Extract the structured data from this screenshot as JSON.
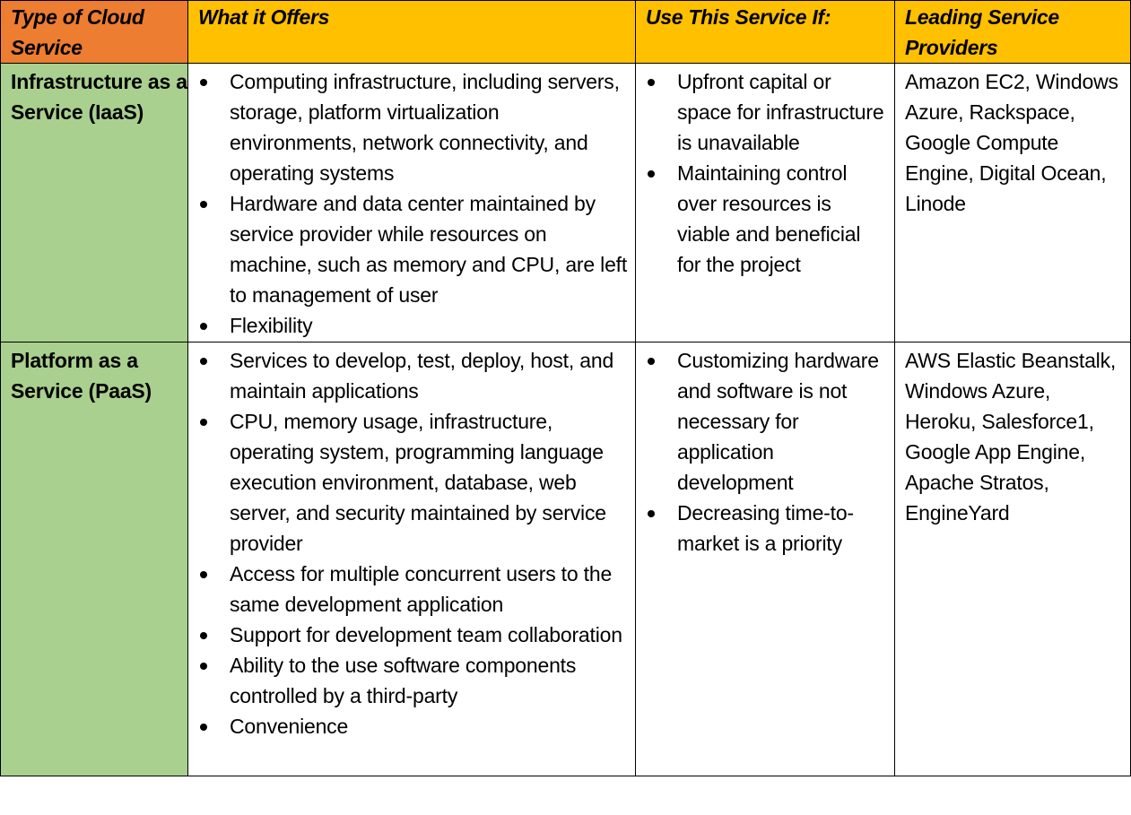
{
  "colors": {
    "header_first": "#ED7D31",
    "header_rest": "#FFC000",
    "type_column": "#A9D08E",
    "body": "#FFFFFF",
    "border": "#000000"
  },
  "table": {
    "headers": [
      "Type of Cloud Service",
      "What it Offers",
      "Use This Service If:",
      "Leading Service Providers"
    ],
    "rows": [
      {
        "type": "Infrastructure as a Service (IaaS)",
        "offers": [
          "Computing infrastructure, including servers, storage, platform virtualization environments, network connectivity, and operating systems",
          "Hardware and data center maintained by service provider while resources on machine, such as memory and CPU, are left to management of user",
          "Flexibility"
        ],
        "use_if": [
          "Upfront capital or space for infrastructure is unavailable",
          "Maintaining control over resources is viable and beneficial for the project"
        ],
        "providers": "Amazon EC2, Windows Azure, Rackspace, Google Compute Engine, Digital Ocean, Linode"
      },
      {
        "type": "Platform as a Service (PaaS)",
        "offers": [
          "Services to develop, test, deploy, host, and maintain applications",
          "CPU, memory usage, infrastructure, operating system, programming language execution environment, database, web server, and security maintained by service provider",
          "Access for multiple concurrent users to the same development application",
          "Support for development team collaboration",
          "Ability to the use software components controlled by a third-party",
          "Convenience"
        ],
        "use_if": [
          "Customizing hardware and software is not necessary for application development",
          "Decreasing time-to-market is a priority"
        ],
        "providers": "AWS Elastic Beanstalk, Windows Azure, Heroku, Salesforce1, Google App Engine, Apache Stratos, EngineYard"
      }
    ]
  }
}
